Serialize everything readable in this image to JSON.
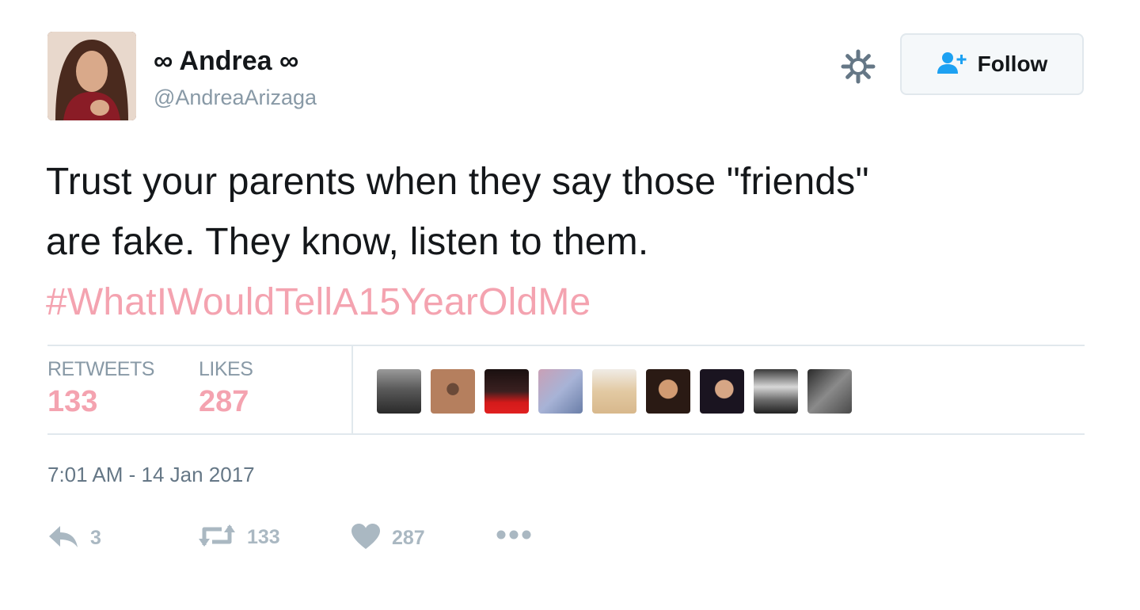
{
  "header": {
    "display_name": "∞ Andrea ∞",
    "screen_name": "@AndreaArizaga",
    "follow_label": "Follow",
    "gear_icon": "gear-icon",
    "follow_icon": "follow-user-plus-icon"
  },
  "tweet": {
    "text_line1": "Trust your parents when they say those \"friends\"",
    "text_line2": "are fake. They know, listen to them.",
    "hashtag": "#WhatIWouldTellA15YearOldMe"
  },
  "stats": {
    "retweets_label": "RETWEETS",
    "retweets_value": "133",
    "likes_label": "LIKES",
    "likes_value": "287"
  },
  "timestamp": "7:01 AM - 14 Jan 2017",
  "actions": {
    "reply_count": "3",
    "retweet_count": "133",
    "like_count": "287",
    "more_icon": "more-dots-icon"
  },
  "colors": {
    "hashtag": "#f4a3b0",
    "stat_value": "#f4a3b0",
    "action_gray": "#aab8c2",
    "secondary_text": "#8899a6"
  }
}
